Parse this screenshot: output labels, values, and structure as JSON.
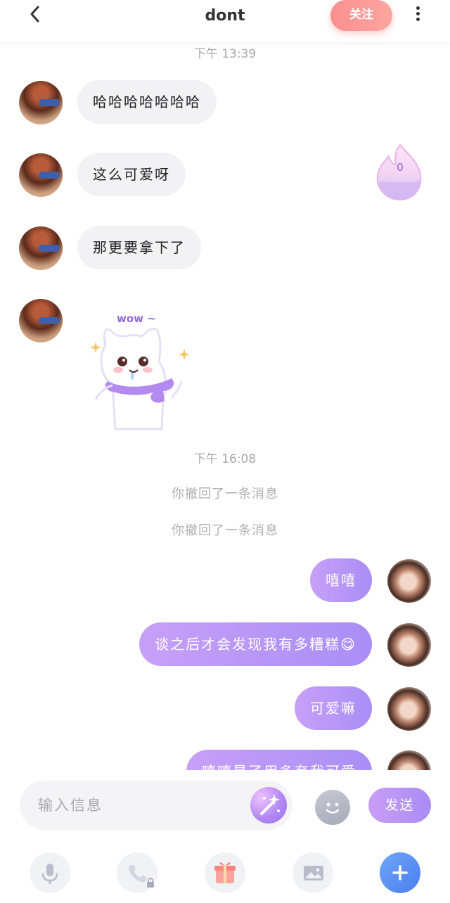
{
  "header": {
    "title": "dont",
    "follow_label": "关注"
  },
  "messages": {
    "time1": "下午 13:39",
    "in1": "哈哈哈哈哈哈哈",
    "in2": "这么可爱呀",
    "in3": "那更要拿下了",
    "sticker_text": "wow ~",
    "time2": "下午 16:08",
    "recall1": "你撤回了一条消息",
    "recall2": "你撤回了一条消息",
    "out1": "嘻嘻",
    "out2": "谈之后才会发现我有多糟糕😋",
    "out3": "可爱嘛",
    "out4": "嘻嘻是了用多夸我可爱"
  },
  "fire_badge": {
    "count": "0"
  },
  "input": {
    "placeholder": "输入信息",
    "send_label": "发送"
  },
  "icons": [
    "back-arrow-icon",
    "more-vertical-icon",
    "fire-icon",
    "magic-wand-icon",
    "smile-icon",
    "microphone-icon",
    "phone-icon",
    "lock-icon",
    "gift-icon",
    "image-icon",
    "plus-icon"
  ],
  "colors": {
    "accent_purple": "#a98ef6",
    "follow_pink": "#fb8f8f",
    "incoming_bubble": "#f2f2f5"
  }
}
